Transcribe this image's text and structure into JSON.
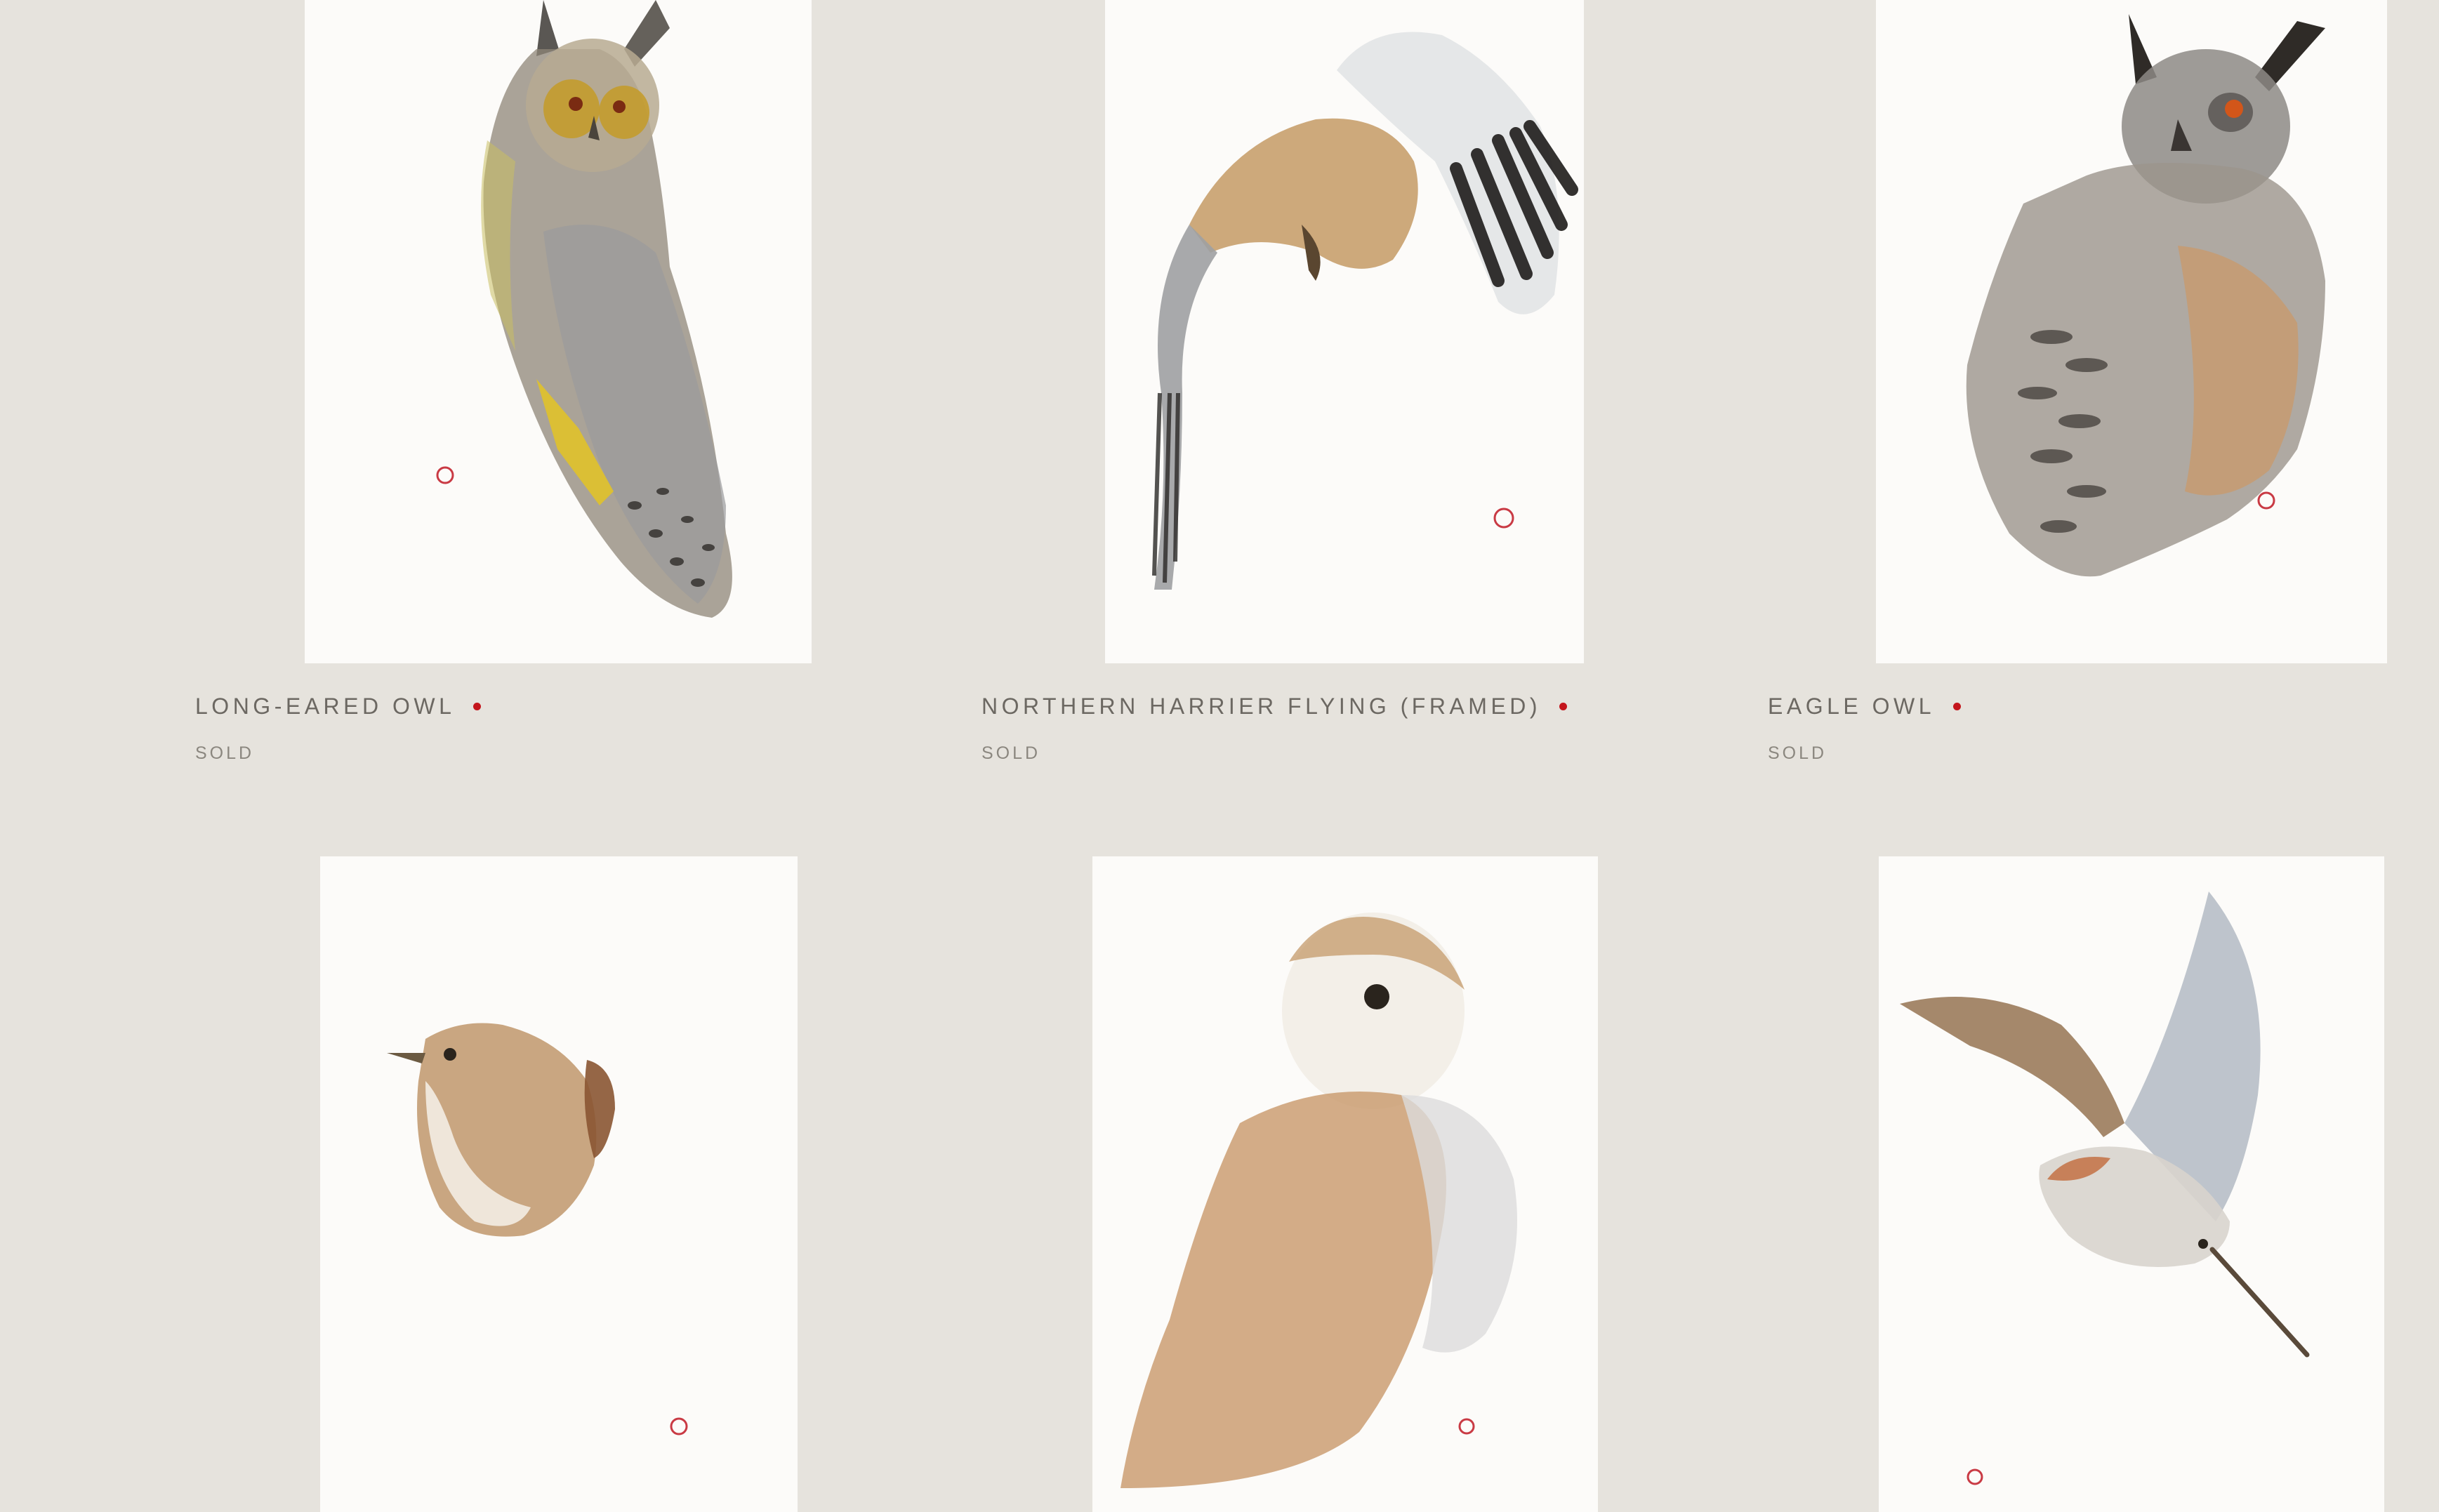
{
  "colors": {
    "page_background": "#e6e3dd",
    "paper": "#fcfbf9",
    "title_text": "#6c6862",
    "status_text": "#8b877f",
    "availability_dot": "#c4161c",
    "stamp": "#c93a44"
  },
  "gallery": {
    "items": [
      {
        "title": "LONG-EARED OWL",
        "status": "SOLD",
        "icon": "long-eared-owl-painting"
      },
      {
        "title": "NORTHERN HARRIER FLYING (FRAMED)",
        "status": "SOLD",
        "icon": "northern-harrier-painting"
      },
      {
        "title": "EAGLE OWL",
        "status": "SOLD",
        "icon": "eagle-owl-painting"
      },
      {
        "icon": "wren-painting"
      },
      {
        "icon": "barn-owl-painting"
      },
      {
        "icon": "woodcock-painting"
      }
    ]
  }
}
